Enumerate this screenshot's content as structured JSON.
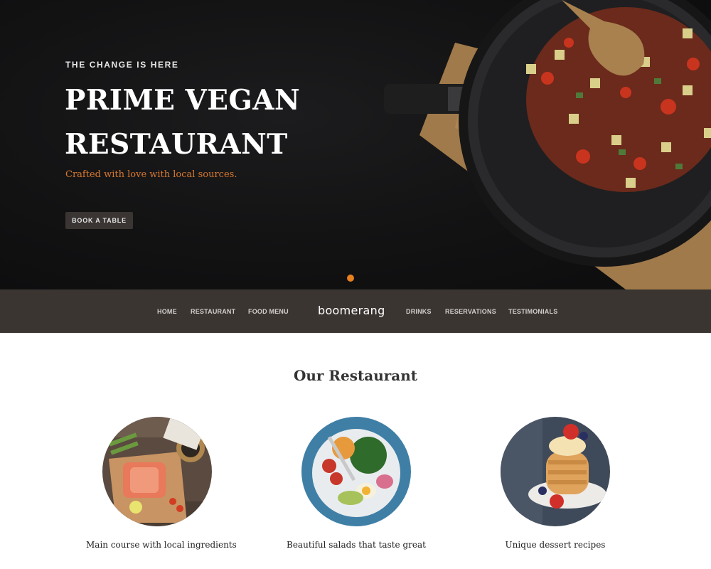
{
  "hero": {
    "eyebrow": "THE CHANGE IS HERE",
    "title": "PRIME VEGAN RESTAURANT",
    "subtitle": "Crafted with love with local sources.",
    "cta_label": "BOOK A TABLE",
    "accent_color": "#e9801f"
  },
  "nav": {
    "left_items": [
      "HOME",
      "RESTAURANT",
      "FOOD MENU"
    ],
    "brand": "boomerang",
    "right_items": [
      "DRINKS",
      "RESERVATIONS",
      "TESTIMONIALS"
    ]
  },
  "main": {
    "section_title": "Our Restaurant",
    "features": [
      {
        "caption": "Main course with local ingredients",
        "image": "main-course-photo"
      },
      {
        "caption": "Beautiful salads that taste great",
        "image": "salad-photo"
      },
      {
        "caption": "Unique dessert recipes",
        "image": "dessert-photo"
      }
    ]
  }
}
